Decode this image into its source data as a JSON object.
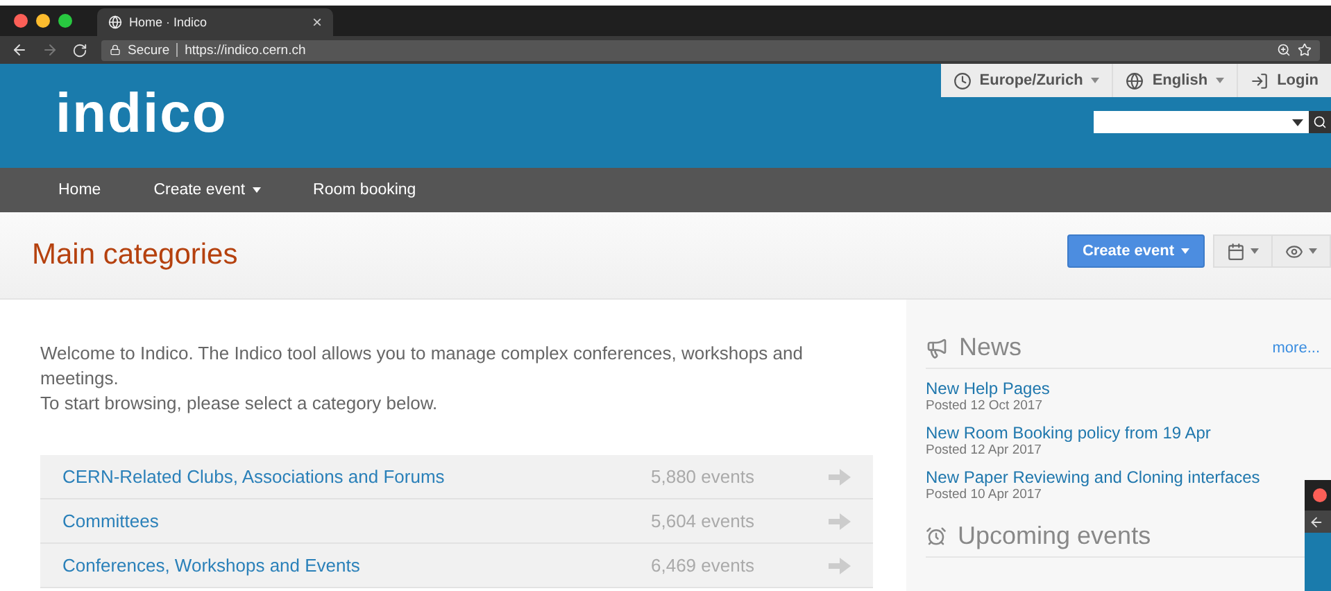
{
  "browser": {
    "tab_title": "Home · Indico",
    "tab_close": "×",
    "secure_label": "Secure",
    "url": "https://indico.cern.ch"
  },
  "header": {
    "logo": "indico",
    "timezone": "Europe/Zurich",
    "language": "English",
    "login": "Login"
  },
  "nav": [
    {
      "label": "Home",
      "dropdown": false
    },
    {
      "label": "Create event",
      "dropdown": true
    },
    {
      "label": "Room booking",
      "dropdown": false
    }
  ],
  "page_title": "Main categories",
  "toolbar": {
    "create_button": "Create event"
  },
  "welcome": [
    "Welcome to Indico. The Indico tool allows you to manage complex conferences, workshops and meetings.",
    "To start browsing, please select a category below."
  ],
  "categories": [
    {
      "name": "CERN-Related Clubs, Associations and Forums",
      "count": "5,880 events"
    },
    {
      "name": "Committees",
      "count": "5,604 events"
    },
    {
      "name": "Conferences, Workshops and Events",
      "count": "6,469 events"
    }
  ],
  "news": {
    "title": "News",
    "more": "more...",
    "items": [
      {
        "title": "New Help Pages",
        "date": "Posted 12 Oct 2017"
      },
      {
        "title": "New Room Booking policy from 19 Apr",
        "date": "Posted 12 Apr 2017"
      },
      {
        "title": "New Paper Reviewing and Cloning interfaces",
        "date": "Posted 10 Apr 2017"
      }
    ]
  },
  "upcoming": {
    "title": "Upcoming events"
  }
}
